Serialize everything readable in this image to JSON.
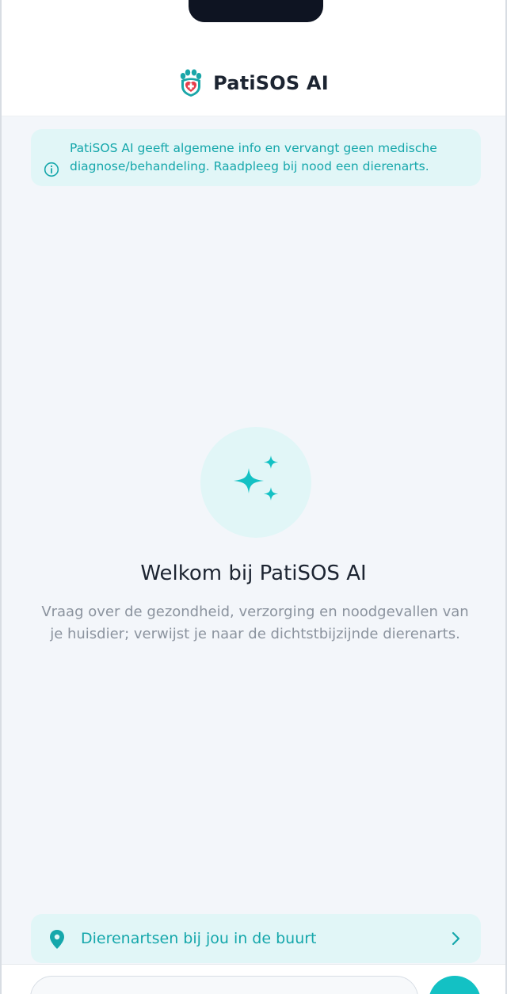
{
  "app": {
    "title": "PatiSOS AI"
  },
  "disclaimer": {
    "text": "PatiSOS AI geeft algemene info en vervangt geen medische diagnose/behandeling. Raadpleeg bij nood een dierenarts.",
    "icon": "info-icon"
  },
  "welcome": {
    "icon": "sparkles-icon",
    "title": "Welkom bij PatiSOS AI",
    "subtitle": "Vraag over de gezondheid, verzorging en noodgevallen van je huisdier; verwijst je naar de dichtstbijzijnde dierenarts."
  },
  "vets_link": {
    "label": "Dierenartsen bij jou in de buurt",
    "icon": "map-pin-icon",
    "chevron": "chevron-right-icon"
  },
  "composer": {
    "value": "",
    "send_icon": "send-icon"
  },
  "colors": {
    "accent": "#13c1c4",
    "accent_text": "#15a7ab",
    "accent_light": "#e1f6f7",
    "heading": "#1c2431",
    "muted": "#8b939e",
    "background": "#f3f6fa",
    "logo_red": "#e83c4a",
    "logo_teal": "#1aa6a8"
  }
}
